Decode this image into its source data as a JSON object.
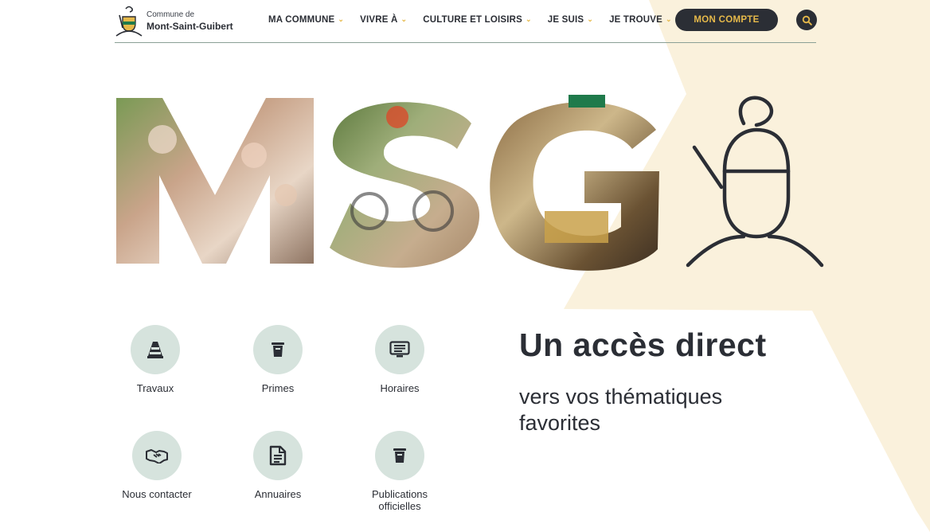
{
  "brand": {
    "prefix": "Commune de",
    "name": "Mont-Saint-Guibert"
  },
  "nav": {
    "items": [
      {
        "label": "MA COMMUNE"
      },
      {
        "label": "VIVRE À"
      },
      {
        "label": "CULTURE ET LOISIRS"
      },
      {
        "label": "JE SUIS"
      },
      {
        "label": "JE TROUVE"
      }
    ],
    "account_label": "MON COMPTE"
  },
  "hero": {
    "letters": "MSG"
  },
  "tiles": [
    {
      "label": "Travaux",
      "icon": "traffic-cone-icon"
    },
    {
      "label": "Primes",
      "icon": "trash-bin-icon"
    },
    {
      "label": "Horaires",
      "icon": "monitor-list-icon"
    },
    {
      "label": "Nous contacter",
      "icon": "handshake-icon"
    },
    {
      "label": "Annuaires",
      "icon": "document-icon"
    },
    {
      "label": "Publications officielles",
      "icon": "trash-bin-icon"
    }
  ],
  "headline": {
    "title": "Un accès direct",
    "subtitle": "vers vos thématiques favorites"
  },
  "colors": {
    "dark": "#2b2e35",
    "accent": "#e6b94a",
    "cream": "#faf1dc",
    "mint": "#d6e3dd",
    "rule": "#8aa096"
  }
}
